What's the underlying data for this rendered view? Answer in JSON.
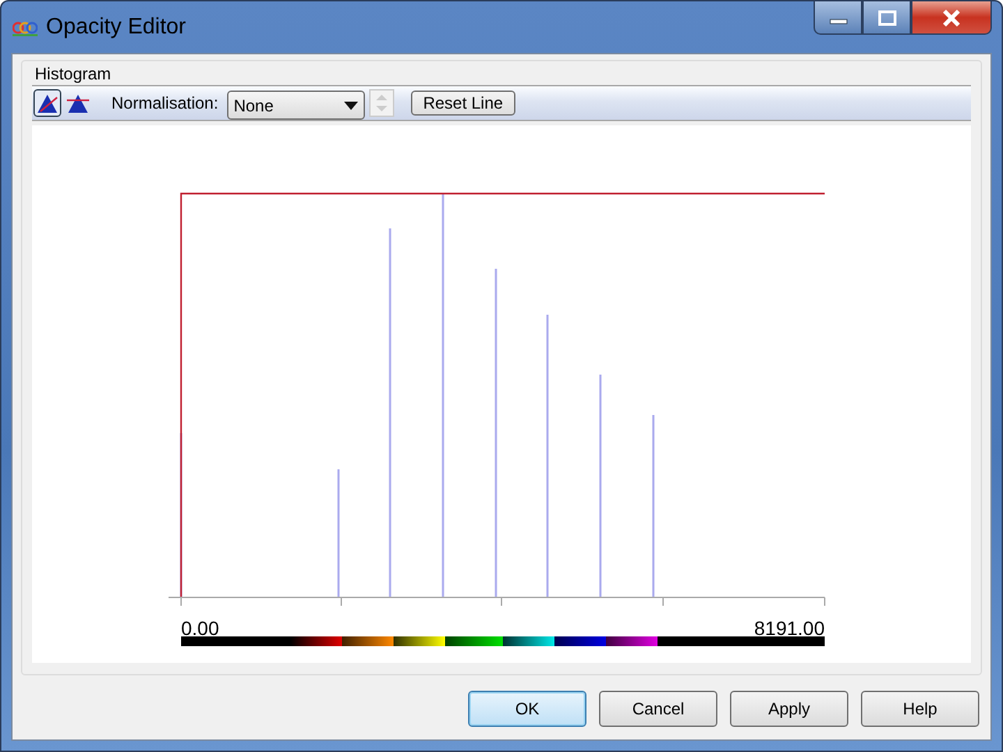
{
  "window": {
    "title": "Opacity Editor"
  },
  "group": {
    "label": "Histogram"
  },
  "toolbar": {
    "modes": [
      {
        "kind": "line",
        "selected": true
      },
      {
        "kind": "flat",
        "selected": false
      }
    ],
    "normalisation_label": "Normalisation:",
    "normalisation_value": "None",
    "reset_button": "Reset Line"
  },
  "plot": {
    "x_min_label": "0.00",
    "x_max_label": "8191.00"
  },
  "buttons": [
    {
      "label": "OK",
      "default": true
    },
    {
      "label": "Cancel",
      "default": false
    },
    {
      "label": "Apply",
      "default": false
    },
    {
      "label": "Help",
      "default": false
    }
  ]
}
